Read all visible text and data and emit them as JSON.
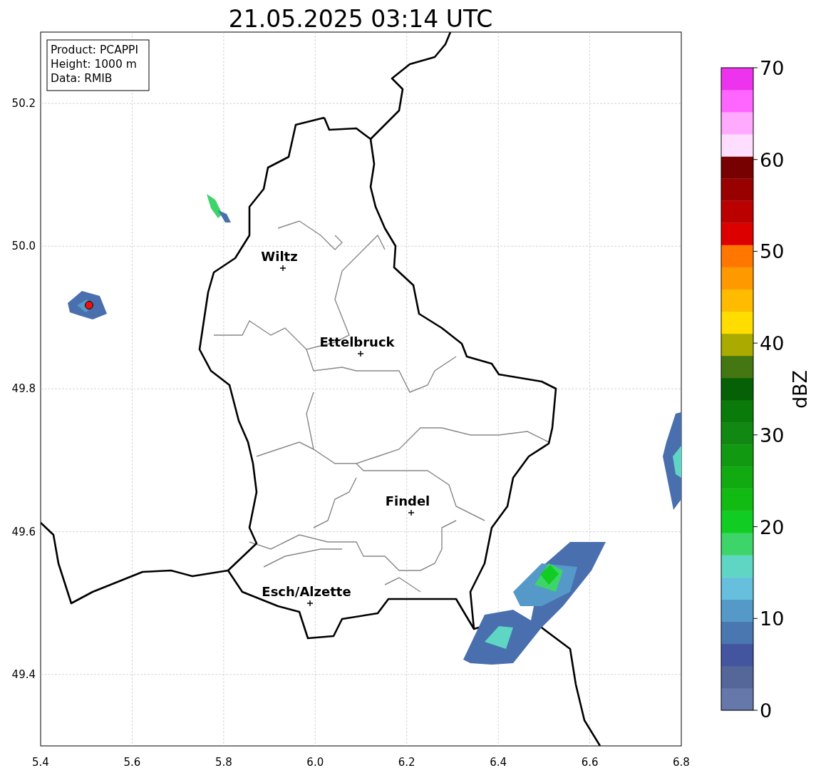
{
  "title": "21.05.2025 03:14 UTC",
  "info_box": [
    "Product: PCAPPI",
    "Height: 1000 m",
    "Data: RMIB"
  ],
  "cities": [
    {
      "name": "Wiltz"
    },
    {
      "name": "Ettelbruck"
    },
    {
      "name": "Findel"
    },
    {
      "name": "Esch/Alzette"
    }
  ],
  "xticks": [
    "5.4",
    "5.6",
    "5.8",
    "6.0",
    "6.2",
    "6.4",
    "6.6",
    "6.8"
  ],
  "yticks": [
    "50.2",
    "50.0",
    "49.8",
    "49.6",
    "49.4"
  ],
  "colorbar": {
    "label": "dBZ",
    "ticks": [
      "70",
      "60",
      "50",
      "40",
      "30",
      "20",
      "10",
      "0"
    ],
    "segments": [
      {
        "color": "#6677aa"
      },
      {
        "color": "#556699"
      },
      {
        "color": "#4455a0"
      },
      {
        "color": "#4a77b0"
      },
      {
        "color": "#5599c8"
      },
      {
        "color": "#66c0dd"
      },
      {
        "color": "#5fd6c4"
      },
      {
        "color": "#3dd46a"
      },
      {
        "color": "#11cc22"
      },
      {
        "color": "#11bb11"
      },
      {
        "color": "#11aa11"
      },
      {
        "color": "#119911"
      },
      {
        "color": "#118811"
      },
      {
        "color": "#0a7a0a"
      },
      {
        "color": "#066006"
      },
      {
        "color": "#447711"
      },
      {
        "color": "#aaaa00"
      },
      {
        "color": "#ffdd00"
      },
      {
        "color": "#ffbb00"
      },
      {
        "color": "#ff9900"
      },
      {
        "color": "#ff7700"
      },
      {
        "color": "#dd0000"
      },
      {
        "color": "#bb0000"
      },
      {
        "color": "#990000"
      },
      {
        "color": "#770000"
      },
      {
        "color": "#ffddff"
      },
      {
        "color": "#ffaaff"
      },
      {
        "color": "#ff66ff"
      },
      {
        "color": "#ee33ee"
      }
    ]
  }
}
